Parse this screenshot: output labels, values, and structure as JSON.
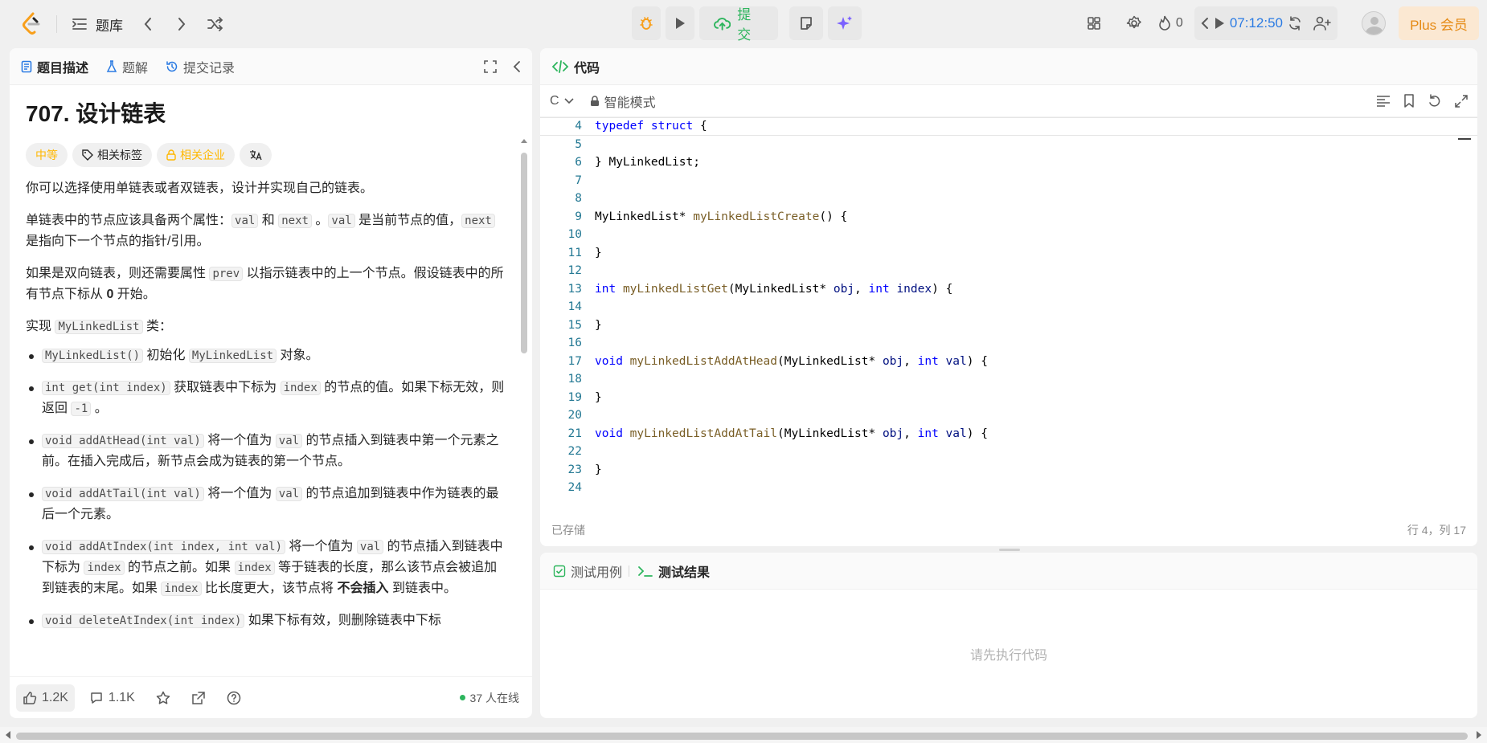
{
  "topbar": {
    "problems_label": "题库",
    "submit_label": "提交",
    "streak_count": "0",
    "timer": "07:12:50",
    "plus_label": "Plus 会员"
  },
  "left": {
    "tabs": [
      {
        "label": "题目描述"
      },
      {
        "label": "题解"
      },
      {
        "label": "提交记录"
      }
    ],
    "title": "707. 设计链表",
    "tags": {
      "difficulty": "中等",
      "related_tags": "相关标签",
      "related_companies": "相关企业"
    },
    "desc": {
      "p1": "你可以选择使用单链表或者双链表，设计并实现自己的链表。",
      "p2a": "单链表中的节点应该具备两个属性：",
      "val": "val",
      "and": " 和 ",
      "next": "next",
      "p2b": " 。",
      "p2c": " 是当前节点的值，",
      "p2d": " 是指向下一个节点的指针/引用。",
      "p3a": "如果是双向链表，则还需要属性 ",
      "prev": "prev",
      "p3b": " 以指示链表中的上一个节点。假设链表中的所有节点下标从 ",
      "zero": "0",
      "p3c": " 开始。",
      "p4a": "实现 ",
      "cls": "MyLinkedList",
      "p4b": " 类：",
      "li1_code": "MyLinkedList()",
      "li1_a": " 初始化 ",
      "li1_code2": "MyLinkedList",
      "li1_b": " 对象。",
      "li2_code": "int get(int index)",
      "li2_a": " 获取链表中下标为 ",
      "li2_code2": "index",
      "li2_b": " 的节点的值。如果下标无效，则返回 ",
      "li2_code3": "-1",
      "li2_c": " 。",
      "li3_code": "void addAtHead(int val)",
      "li3_a": " 将一个值为 ",
      "li3_code2": "val",
      "li3_b": " 的节点插入到链表中第一个元素之前。在插入完成后，新节点会成为链表的第一个节点。",
      "li4_code": "void addAtTail(int val)",
      "li4_a": " 将一个值为 ",
      "li4_code2": "val",
      "li4_b": " 的节点追加到链表中作为链表的最后一个元素。",
      "li5_code": "void addAtIndex(int index, int val)",
      "li5_a": " 将一个值为 ",
      "li5_code2": "val",
      "li5_b": " 的节点插入到链表中下标为 ",
      "li5_code3": "index",
      "li5_c": " 的节点之前。如果 ",
      "li5_code4": "index",
      "li5_d": " 等于链表的长度，那么该节点会被追加到链表的末尾。如果 ",
      "li5_code5": "index",
      "li5_e": " 比长度更大，该节点将 ",
      "li5_bold": "不会插入",
      "li5_f": " 到链表中。",
      "li6_code": "void deleteAtIndex(int index)",
      "li6_a": " 如果下标有效，则删除链表中下标"
    },
    "footer": {
      "likes": "1.2K",
      "comments": "1.1K",
      "online": "37 人在线"
    }
  },
  "code": {
    "tab_label": "代码",
    "lang": "C",
    "mode": "智能模式",
    "saved": "已存储",
    "cursor": "行 4，列 17",
    "lines": [
      {
        "n": "4",
        "html": "<span class='kw'>typedef</span> <span class='kw'>struct</span> {"
      },
      {
        "n": "5",
        "html": ""
      },
      {
        "n": "6",
        "html": "} MyLinkedList;"
      },
      {
        "n": "7",
        "html": ""
      },
      {
        "n": "8",
        "html": ""
      },
      {
        "n": "9",
        "html": "MyLinkedList* <span class='fn'>myLinkedListCreate</span>() {"
      },
      {
        "n": "10",
        "html": ""
      },
      {
        "n": "11",
        "html": "}"
      },
      {
        "n": "12",
        "html": ""
      },
      {
        "n": "13",
        "html": "<span class='kw'>int</span> <span class='fn'>myLinkedListGet</span>(MyLinkedList* <span class='pm'>obj</span>, <span class='kw'>int</span> <span class='pm'>index</span>) {"
      },
      {
        "n": "14",
        "html": ""
      },
      {
        "n": "15",
        "html": "}"
      },
      {
        "n": "16",
        "html": ""
      },
      {
        "n": "17",
        "html": "<span class='kw'>void</span> <span class='fn'>myLinkedListAddAtHead</span>(MyLinkedList* <span class='pm'>obj</span>, <span class='kw'>int</span> <span class='pm'>val</span>) {"
      },
      {
        "n": "18",
        "html": ""
      },
      {
        "n": "19",
        "html": "}"
      },
      {
        "n": "20",
        "html": ""
      },
      {
        "n": "21",
        "html": "<span class='kw'>void</span> <span class='fn'>myLinkedListAddAtTail</span>(MyLinkedList* <span class='pm'>obj</span>, <span class='kw'>int</span> <span class='pm'>val</span>) {"
      },
      {
        "n": "22",
        "html": ""
      },
      {
        "n": "23",
        "html": "}"
      },
      {
        "n": "24",
        "html": ""
      }
    ]
  },
  "test": {
    "tab_cases": "测试用例",
    "tab_result": "测试结果",
    "empty": "请先执行代码"
  }
}
